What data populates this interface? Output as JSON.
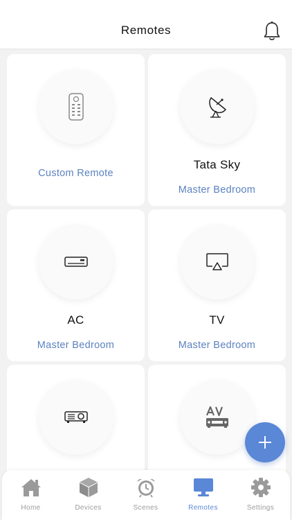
{
  "header": {
    "title": "Remotes"
  },
  "cards": [
    {
      "name": "",
      "room": "Custom Remote",
      "icon": "remote-icon"
    },
    {
      "name": "Tata Sky",
      "room": "Master Bedroom",
      "icon": "satellite-dish-icon"
    },
    {
      "name": "AC",
      "room": "Master Bedroom",
      "icon": "air-conditioner-icon"
    },
    {
      "name": "TV",
      "room": "Master Bedroom",
      "icon": "airplay-tv-icon"
    },
    {
      "name": "",
      "room": "",
      "icon": "projector-icon"
    },
    {
      "name": "",
      "room": "",
      "icon": "av-receiver-icon"
    }
  ],
  "tabs": [
    {
      "label": "Home",
      "icon": "home-icon"
    },
    {
      "label": "Devices",
      "icon": "devices-cube-icon"
    },
    {
      "label": "Scenes",
      "icon": "alarm-clock-icon"
    },
    {
      "label": "Remotes",
      "icon": "monitor-icon"
    },
    {
      "label": "Settings",
      "icon": "gear-icon"
    }
  ],
  "colors": {
    "accent": "#5a87d6",
    "room_text": "#5b82c0",
    "inactive": "#9a9a9a"
  }
}
